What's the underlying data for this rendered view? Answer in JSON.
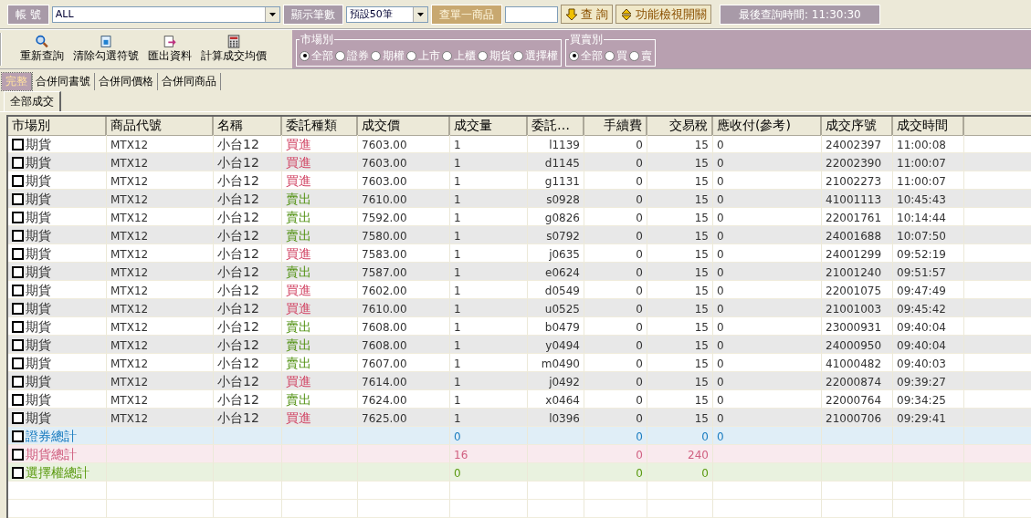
{
  "query_bar": {
    "account_label": "帳 號",
    "account_value": "ALL",
    "count_label": "顯示筆數",
    "count_value": "預設50筆",
    "product_label": "查單一商品",
    "search_button": "查 詢",
    "toggle_button": "功能檢視開關",
    "last_query": "最後查詢時間: 11:30:30"
  },
  "toolbar": [
    {
      "kind": "search",
      "label": "重新查詢"
    },
    {
      "kind": "clear",
      "label": "清除勾選符號"
    },
    {
      "kind": "export",
      "label": "匯出資料"
    },
    {
      "kind": "calc",
      "label": "計算成交均價"
    }
  ],
  "market_group": {
    "title": "市場別",
    "options": [
      {
        "label": "全部",
        "selected": true
      },
      {
        "label": "證券",
        "selected": false
      },
      {
        "label": "期權",
        "selected": false
      },
      {
        "label": "上市",
        "selected": false
      },
      {
        "label": "上櫃",
        "selected": false
      },
      {
        "label": "期貨",
        "selected": false
      },
      {
        "label": "選擇權",
        "selected": false
      }
    ]
  },
  "side_group": {
    "title": "買賣別",
    "options": [
      {
        "label": "全部",
        "selected": true
      },
      {
        "label": "買",
        "selected": false
      },
      {
        "label": "賣",
        "selected": false
      }
    ]
  },
  "tabs": [
    {
      "label": "完整",
      "selected": true
    },
    {
      "label": "合併同書號",
      "selected": false
    },
    {
      "label": "合併同價格",
      "selected": false
    },
    {
      "label": "合併同商品",
      "selected": false
    }
  ],
  "subtabs": [
    {
      "label": "全部成交",
      "selected": true
    }
  ],
  "table": {
    "columns": [
      "市場別",
      "商品代號",
      "名稱",
      "委託種類",
      "成交價",
      "成交量",
      "委託…",
      "手續費",
      "交易稅",
      "應收付(參考)",
      "成交序號",
      "成交時間"
    ],
    "rows": [
      {
        "checked": false,
        "market": "期貨",
        "code": "MTX12",
        "name": "小台12",
        "kind": "buy",
        "order_type": "買進",
        "price": "7603.00",
        "qty": "1",
        "order": "l1139",
        "fee": "0",
        "tax": "15",
        "net": "0",
        "seq": "24002397",
        "time": "11:00:08"
      },
      {
        "checked": false,
        "market": "期貨",
        "code": "MTX12",
        "name": "小台12",
        "kind": "buy",
        "order_type": "買進",
        "price": "7603.00",
        "qty": "1",
        "order": "d1145",
        "fee": "0",
        "tax": "15",
        "net": "0",
        "seq": "22002390",
        "time": "11:00:07"
      },
      {
        "checked": false,
        "market": "期貨",
        "code": "MTX12",
        "name": "小台12",
        "kind": "buy",
        "order_type": "買進",
        "price": "7603.00",
        "qty": "1",
        "order": "g1131",
        "fee": "0",
        "tax": "15",
        "net": "0",
        "seq": "21002273",
        "time": "11:00:07"
      },
      {
        "checked": false,
        "market": "期貨",
        "code": "MTX12",
        "name": "小台12",
        "kind": "sell",
        "order_type": "賣出",
        "price": "7610.00",
        "qty": "1",
        "order": "s0928",
        "fee": "0",
        "tax": "15",
        "net": "0",
        "seq": "41001113",
        "time": "10:45:43"
      },
      {
        "checked": false,
        "market": "期貨",
        "code": "MTX12",
        "name": "小台12",
        "kind": "sell",
        "order_type": "賣出",
        "price": "7592.00",
        "qty": "1",
        "order": "g0826",
        "fee": "0",
        "tax": "15",
        "net": "0",
        "seq": "22001761",
        "time": "10:14:44"
      },
      {
        "checked": false,
        "market": "期貨",
        "code": "MTX12",
        "name": "小台12",
        "kind": "sell",
        "order_type": "賣出",
        "price": "7580.00",
        "qty": "1",
        "order": "s0792",
        "fee": "0",
        "tax": "15",
        "net": "0",
        "seq": "24001688",
        "time": "10:07:50"
      },
      {
        "checked": false,
        "market": "期貨",
        "code": "MTX12",
        "name": "小台12",
        "kind": "buy",
        "order_type": "買進",
        "price": "7583.00",
        "qty": "1",
        "order": "j0635",
        "fee": "0",
        "tax": "15",
        "net": "0",
        "seq": "24001299",
        "time": "09:52:19"
      },
      {
        "checked": false,
        "market": "期貨",
        "code": "MTX12",
        "name": "小台12",
        "kind": "sell",
        "order_type": "賣出",
        "price": "7587.00",
        "qty": "1",
        "order": "e0624",
        "fee": "0",
        "tax": "15",
        "net": "0",
        "seq": "21001240",
        "time": "09:51:57"
      },
      {
        "checked": false,
        "market": "期貨",
        "code": "MTX12",
        "name": "小台12",
        "kind": "buy",
        "order_type": "買進",
        "price": "7602.00",
        "qty": "1",
        "order": "d0549",
        "fee": "0",
        "tax": "15",
        "net": "0",
        "seq": "22001075",
        "time": "09:47:49"
      },
      {
        "checked": false,
        "market": "期貨",
        "code": "MTX12",
        "name": "小台12",
        "kind": "buy",
        "order_type": "買進",
        "price": "7610.00",
        "qty": "1",
        "order": "u0525",
        "fee": "0",
        "tax": "15",
        "net": "0",
        "seq": "21001003",
        "time": "09:45:42"
      },
      {
        "checked": false,
        "market": "期貨",
        "code": "MTX12",
        "name": "小台12",
        "kind": "sell",
        "order_type": "賣出",
        "price": "7608.00",
        "qty": "1",
        "order": "b0479",
        "fee": "0",
        "tax": "15",
        "net": "0",
        "seq": "23000931",
        "time": "09:40:04"
      },
      {
        "checked": false,
        "market": "期貨",
        "code": "MTX12",
        "name": "小台12",
        "kind": "sell",
        "order_type": "賣出",
        "price": "7608.00",
        "qty": "1",
        "order": "y0494",
        "fee": "0",
        "tax": "15",
        "net": "0",
        "seq": "24000950",
        "time": "09:40:04"
      },
      {
        "checked": false,
        "market": "期貨",
        "code": "MTX12",
        "name": "小台12",
        "kind": "sell",
        "order_type": "賣出",
        "price": "7607.00",
        "qty": "1",
        "order": "m0490",
        "fee": "0",
        "tax": "15",
        "net": "0",
        "seq": "41000482",
        "time": "09:40:03"
      },
      {
        "checked": false,
        "market": "期貨",
        "code": "MTX12",
        "name": "小台12",
        "kind": "buy",
        "order_type": "買進",
        "price": "7614.00",
        "qty": "1",
        "order": "j0492",
        "fee": "0",
        "tax": "15",
        "net": "0",
        "seq": "22000874",
        "time": "09:39:27"
      },
      {
        "checked": false,
        "market": "期貨",
        "code": "MTX12",
        "name": "小台12",
        "kind": "sell",
        "order_type": "賣出",
        "price": "7624.00",
        "qty": "1",
        "order": "x0464",
        "fee": "0",
        "tax": "15",
        "net": "0",
        "seq": "22000764",
        "time": "09:34:25"
      },
      {
        "checked": false,
        "market": "期貨",
        "code": "MTX12",
        "name": "小台12",
        "kind": "buy",
        "order_type": "買進",
        "price": "7625.00",
        "qty": "1",
        "order": "l0396",
        "fee": "0",
        "tax": "15",
        "net": "0",
        "seq": "21000706",
        "time": "09:29:41"
      }
    ],
    "totals": [
      {
        "checked": false,
        "label": "證券總計",
        "color": "#1a7cc0",
        "qty": "0",
        "fee": "0",
        "tax": "0",
        "net": "0"
      },
      {
        "checked": false,
        "label": "期貨總計",
        "color": "#d06080",
        "qty": "16",
        "fee": "0",
        "tax": "240"
      },
      {
        "checked": false,
        "label": "選擇權總計",
        "color": "#5a9a10",
        "qty": "0",
        "fee": "0",
        "tax": "0"
      }
    ]
  }
}
